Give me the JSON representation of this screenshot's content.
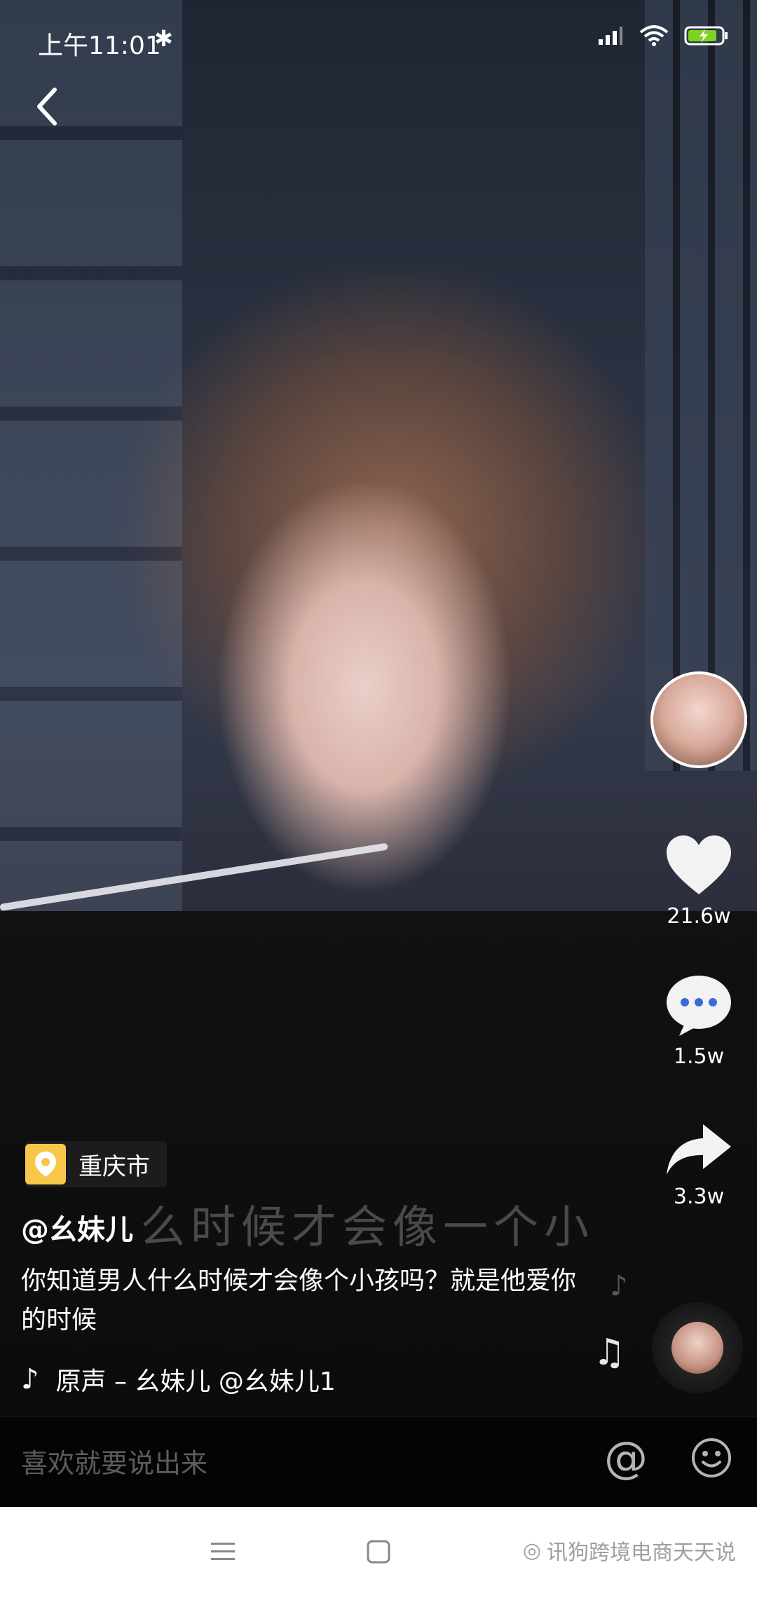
{
  "status_bar": {
    "time": "上午11:01",
    "battery_color": "#7ed321"
  },
  "video": {
    "lyric_overlay": "么时候才会像一个小",
    "location": "重庆市",
    "author": "@幺妹儿",
    "description": "你知道男人什么时候才会像个小孩吗？就是他爱你的时候",
    "music_text": "原声 – 幺妹儿    @幺妹儿1"
  },
  "right_rail": {
    "likes": "21.6w",
    "comments": "1.5w",
    "shares": "3.3w"
  },
  "comment_bar": {
    "placeholder": "喜欢就要说出来",
    "at_symbol": "@"
  },
  "navbar": {
    "watermark": "讯狗跨境电商天天说"
  },
  "icons": {
    "back": "back-icon",
    "heart": "heart-icon",
    "comment": "comment-icon",
    "share": "share-icon",
    "music": "music-note-icon",
    "location": "location-pin-icon",
    "emoji": "emoji-icon"
  }
}
